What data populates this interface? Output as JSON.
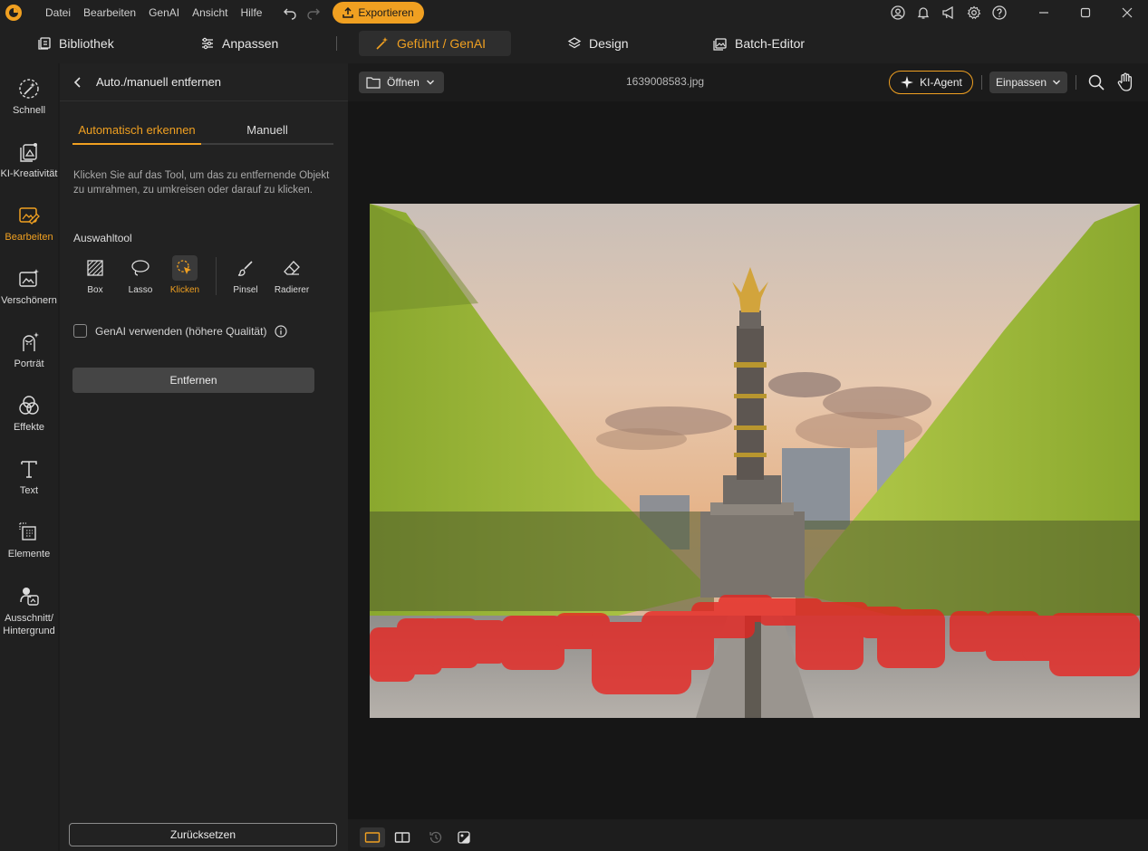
{
  "menu": {
    "items": [
      "Datei",
      "Bearbeiten",
      "GenAI",
      "Ansicht",
      "Hilfe"
    ]
  },
  "titlebar": {
    "export_label": "Exportieren"
  },
  "nav": {
    "tabs": [
      {
        "label": "Bibliothek"
      },
      {
        "label": "Anpassen"
      },
      {
        "label": "Geführt / GenAI"
      },
      {
        "label": "Design"
      },
      {
        "label": "Batch-Editor"
      }
    ]
  },
  "rail": {
    "items": [
      {
        "label": "Schnell",
        "icon": "magic-wand-icon"
      },
      {
        "label": "KI-Kreativität",
        "icon": "ai-creativity-icon"
      },
      {
        "label": "Bearbeiten",
        "icon": "edit-image-icon"
      },
      {
        "label": "Verschönern",
        "icon": "beautify-icon"
      },
      {
        "label": "Porträt",
        "icon": "portrait-icon"
      },
      {
        "label": "Effekte",
        "icon": "effects-icon"
      },
      {
        "label": "Text",
        "icon": "text-icon"
      },
      {
        "label": "Elemente",
        "icon": "elements-icon"
      },
      {
        "label": "Ausschnitt/",
        "label2": "Hintergrund",
        "icon": "cutout-icon"
      }
    ]
  },
  "panel": {
    "title": "Auto./manuell entfernen",
    "tab_auto": "Automatisch erkennen",
    "tab_manual": "Manuell",
    "help_text": "Klicken Sie auf das Tool, um das zu entfernende Objekt zu umrahmen, zu umkreisen oder darauf zu klicken.",
    "tool_label": "Auswahltool",
    "tools": [
      "Box",
      "Lasso",
      "Klicken",
      "Pinsel",
      "Radierer"
    ],
    "genai_label": "GenAI verwenden (höhere Qualität)",
    "remove_label": "Entfernen",
    "reset_label": "Zurücksetzen"
  },
  "canvas": {
    "open_label": "Öffnen",
    "file_name": "1639008583.jpg",
    "agent_label": "KI-Agent",
    "fit_label": "Einpassen"
  },
  "colors": {
    "accent": "#f0a021",
    "mask": "#e8231f"
  }
}
